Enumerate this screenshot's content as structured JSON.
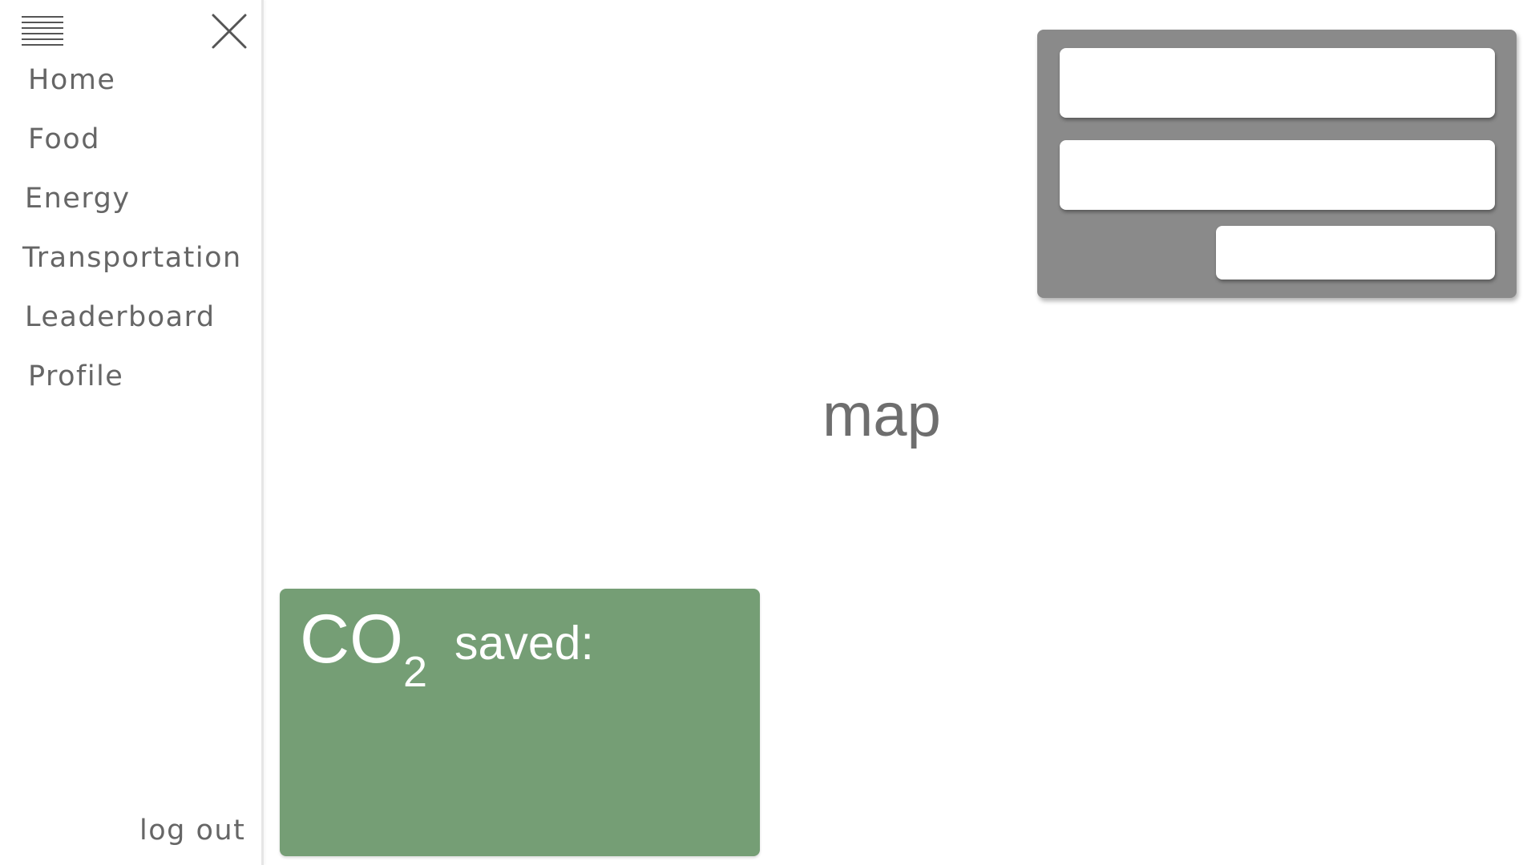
{
  "sidebar": {
    "items": [
      {
        "label": "Home"
      },
      {
        "label": "Food"
      },
      {
        "label": "Energy"
      },
      {
        "label": "Transportation"
      },
      {
        "label": "Leaderboard"
      },
      {
        "label": "Profile"
      }
    ],
    "logout_label": "log out",
    "menu_icon": "hamburger-menu-icon",
    "close_icon": "close-icon"
  },
  "main": {
    "map_placeholder": "map"
  },
  "search_panel": {
    "field1_value": "",
    "field2_value": "",
    "button_label": ""
  },
  "co2_card": {
    "title_main": "CO",
    "title_sub": "2",
    "saved_label": "saved:",
    "background_color": "#759e75"
  },
  "colors": {
    "nav_text": "#666666",
    "panel_bg": "#8a8a8a",
    "card_green": "#759e75"
  }
}
